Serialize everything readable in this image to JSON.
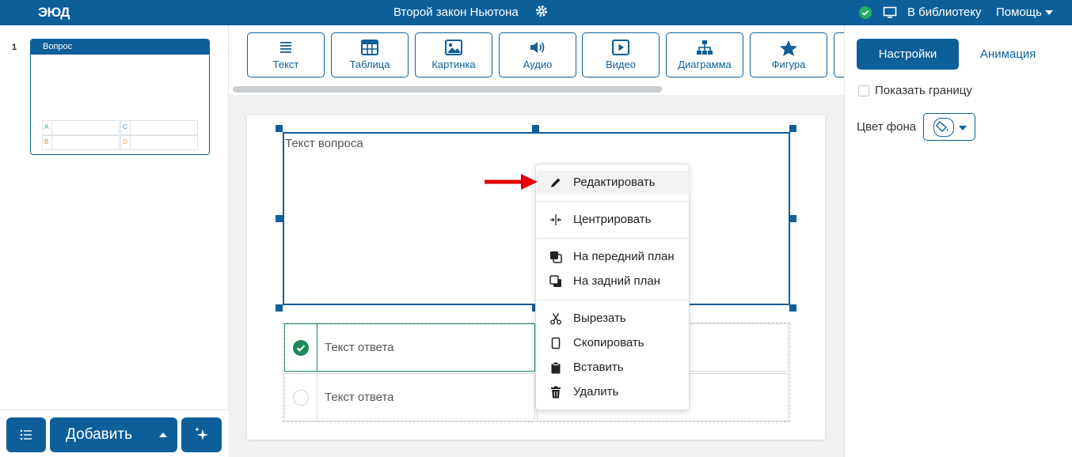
{
  "topbar": {
    "logo": "ЭЮД",
    "title": "Второй закон Ньютона",
    "library_link": "В библиотеку",
    "help_link": "Помощь"
  },
  "slides_panel": {
    "slides": [
      {
        "number": "1",
        "title": "Вопрос",
        "answer_letters": [
          "A",
          "C",
          "B",
          "D"
        ]
      }
    ],
    "add_button": "Добавить"
  },
  "toolbar": {
    "tools": [
      {
        "label": "Текст",
        "icon": "text-lines-icon"
      },
      {
        "label": "Таблица",
        "icon": "table-icon"
      },
      {
        "label": "Картинка",
        "icon": "image-icon"
      },
      {
        "label": "Аудио",
        "icon": "speaker-icon"
      },
      {
        "label": "Видео",
        "icon": "play-icon"
      },
      {
        "label": "Диаграмма",
        "icon": "diagram-icon"
      },
      {
        "label": "Фигура",
        "icon": "star-icon"
      }
    ]
  },
  "slide": {
    "question_placeholder": "Текст вопроса",
    "answers": [
      {
        "text": "Текст ответа",
        "correct": true
      },
      {
        "text": "Текст ответа",
        "correct": false
      }
    ]
  },
  "context_menu": {
    "items": [
      {
        "label": "Редактировать",
        "icon": "pencil-icon"
      },
      {
        "label": "Центрировать",
        "icon": "center-icon"
      },
      {
        "label": "На передний план",
        "icon": "bring-front-icon"
      },
      {
        "label": "На задний план",
        "icon": "send-back-icon"
      },
      {
        "label": "Вырезать",
        "icon": "scissors-icon"
      },
      {
        "label": "Скопировать",
        "icon": "copy-icon"
      },
      {
        "label": "Вставить",
        "icon": "paste-icon"
      },
      {
        "label": "Удалить",
        "icon": "trash-icon"
      }
    ]
  },
  "properties": {
    "tabs": [
      "Настройки",
      "Анимация"
    ],
    "show_border_label": "Показать границу",
    "show_border_checked": false,
    "bg_color_label": "Цвет фона"
  },
  "colors": {
    "brand": "#0d5f99",
    "success": "#1e8a5c",
    "annotation_arrow": "#e60000"
  }
}
